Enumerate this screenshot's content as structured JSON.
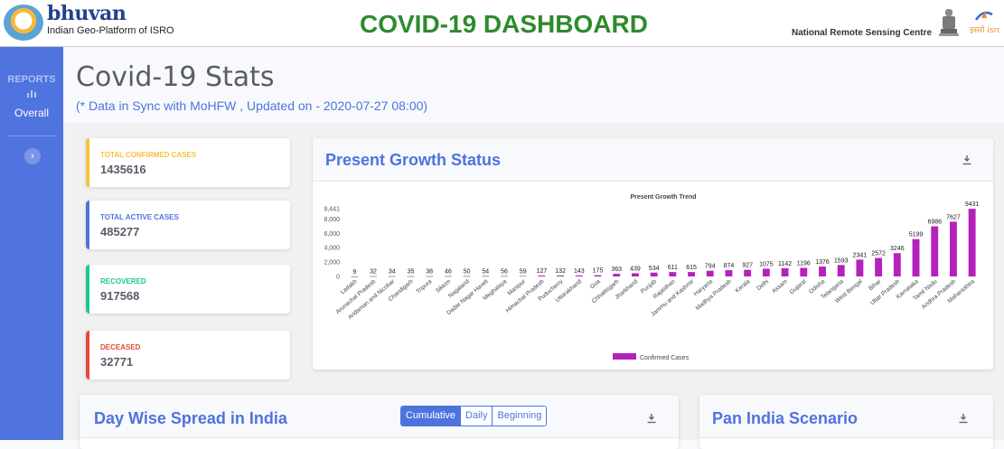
{
  "header": {
    "logo_title": "bhuvan",
    "logo_subtitle": "Indian Geo-Platform of ISRO",
    "dashboard_title": "COVID-19 DASHBOARD",
    "org": "National Remote Sensing Centre",
    "isro_label": "इसरो isro"
  },
  "sidebar": {
    "reports_label": "REPORTS",
    "overall_label": "Overall"
  },
  "page": {
    "title": "Covid-19 Stats",
    "sync_prefix": "(* Data in Sync with ",
    "sync_link": "MoHFW",
    "sync_suffix": " , Updated on - 2020-07-27 08:00)"
  },
  "cards": [
    {
      "label": "TOTAL CONFIRMED CASES",
      "value": "1435616",
      "color": "#f6c23e"
    },
    {
      "label": "TOTAL ACTIVE CASES",
      "value": "485277",
      "color": "#4e73df"
    },
    {
      "label": "RECOVERED",
      "value": "917568",
      "color": "#1cc88a"
    },
    {
      "label": "DECEASED",
      "value": "32771",
      "color": "#e74a3b"
    }
  ],
  "growth_panel": {
    "title": "Present Growth Status"
  },
  "day_wise_panel": {
    "title": "Day Wise Spread in India",
    "buttons": [
      "Cumulative",
      "Daily",
      "Beginning"
    ]
  },
  "pan_india_panel": {
    "title": "Pan India Scenario"
  },
  "chart_data": {
    "type": "bar",
    "title": "Present Growth Trend",
    "legend": [
      "Confirmed Cases"
    ],
    "legend_position": "bottom",
    "color": "#b521bc",
    "ylim": [
      0,
      9441
    ],
    "yticks": [
      "9,441",
      "8,000",
      "6,000",
      "4,000",
      "2,000",
      "0"
    ],
    "ytick_values": [
      9441,
      8000,
      6000,
      4000,
      2000,
      0
    ],
    "categories": [
      "Ladakh",
      "Arunachal Pradesh",
      "Andaman and Nicobar",
      "Chandigarh",
      "Tripura",
      "Sikkim",
      "Nagaland",
      "Dadar Nagar Haveli",
      "Meghalaya",
      "Manipur",
      "Himachal Pradesh",
      "Puducherry",
      "Uttarakhand",
      "Goa",
      "Chhattisgarh",
      "Jharkhand",
      "Punjab",
      "Rajasthan",
      "Jammu and Kashmir",
      "Haryana",
      "Madhya Pradesh",
      "Kerala",
      "Delhi",
      "Assam",
      "Gujarat",
      "Odisha",
      "Telangana",
      "West Bengal",
      "Bihar",
      "Uttar Pradesh",
      "Karnataka",
      "Tamil Nadu",
      "Andhra Pradesh",
      "Maharashtra"
    ],
    "values": [
      9,
      32,
      34,
      35,
      38,
      46,
      50,
      54,
      56,
      59,
      127,
      132,
      143,
      175,
      363,
      439,
      534,
      611,
      615,
      794,
      874,
      927,
      1075,
      1142,
      1196,
      1376,
      1593,
      2341,
      2572,
      3246,
      5199,
      6986,
      7627,
      9431
    ]
  }
}
